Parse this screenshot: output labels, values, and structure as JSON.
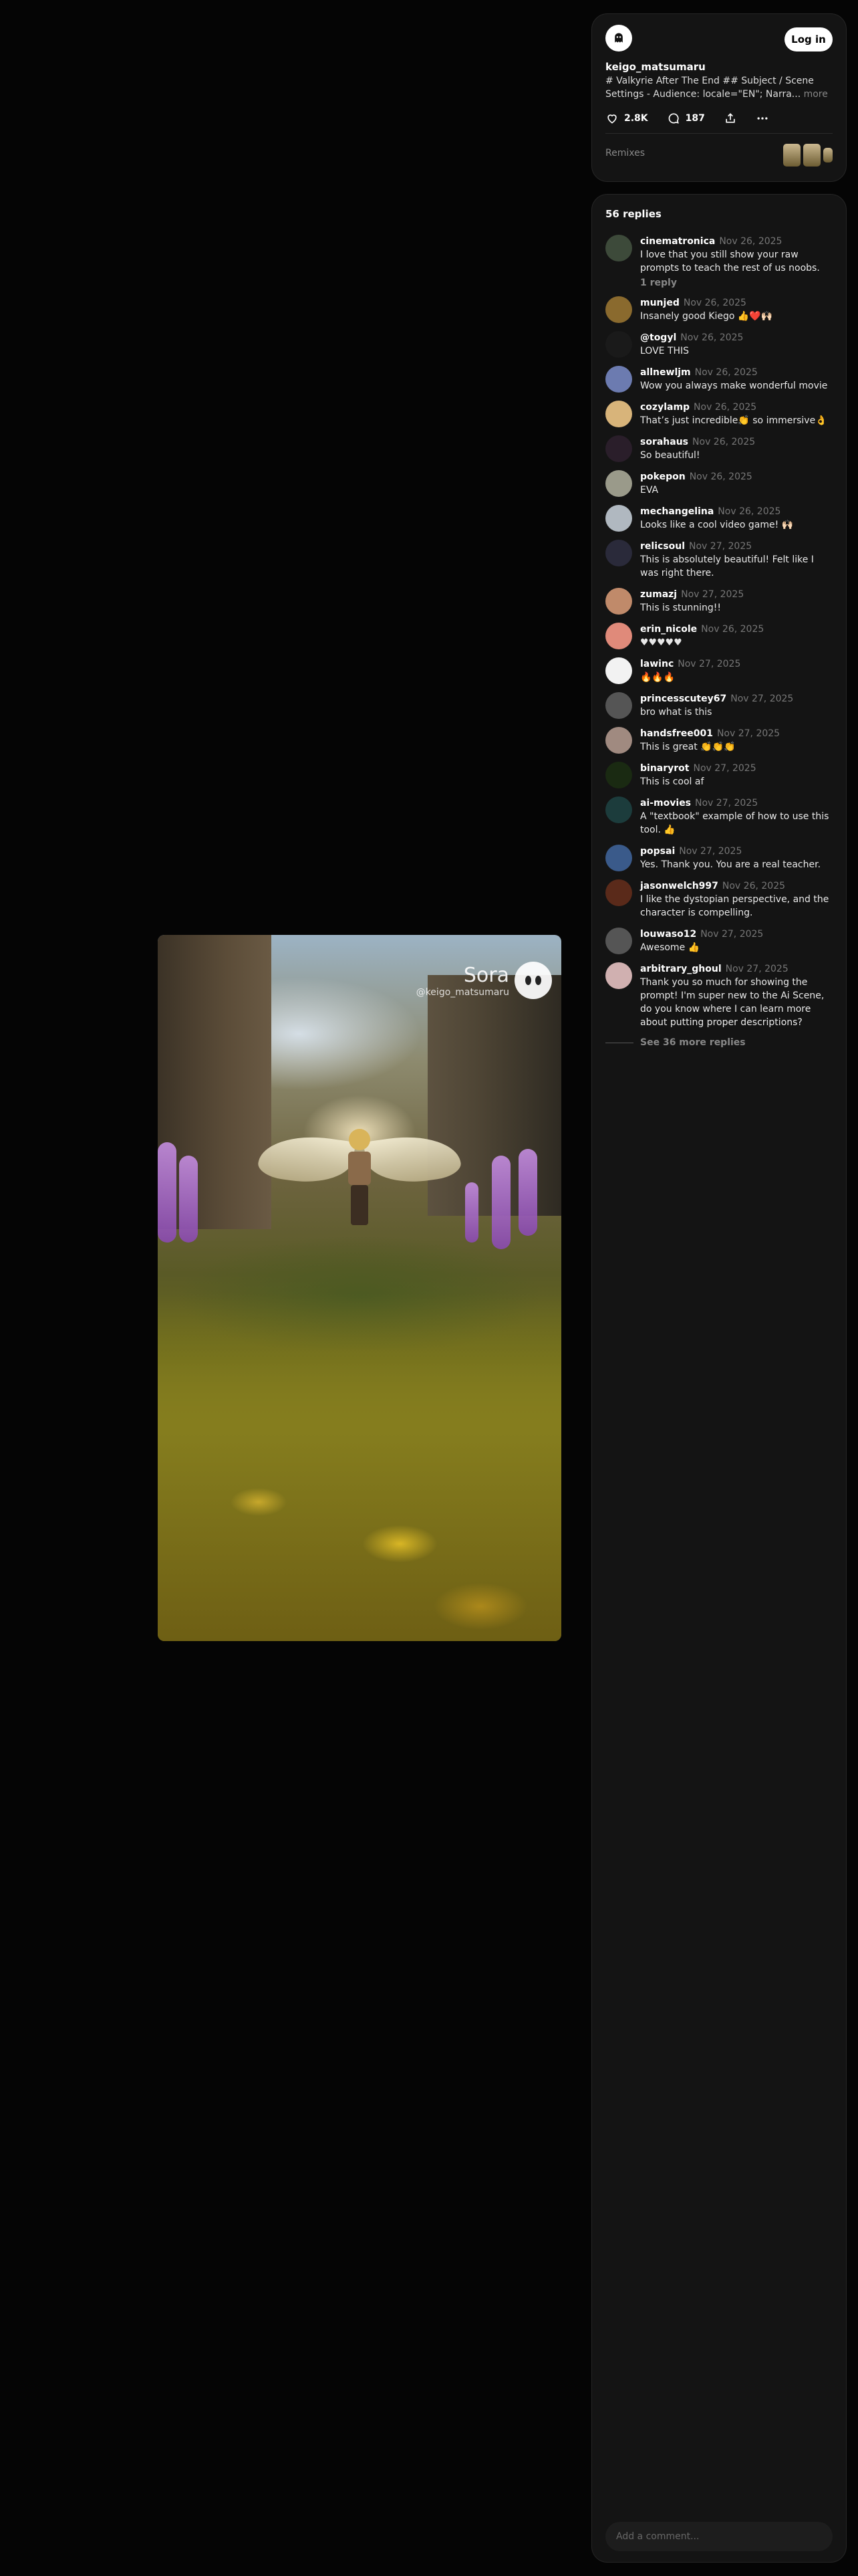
{
  "video": {
    "watermark_brand": "Sora",
    "watermark_user": "@keigo_matsumaru"
  },
  "post": {
    "author": "keigo_matsumaru",
    "description": "# Valkyrie After The End ## Subject / Scene Settings - Audience: locale=\"EN\"; Narra...",
    "more_label": "more",
    "login_label": "Log in",
    "likes": "2.8K",
    "comments_count": "187",
    "remixes_label": "Remixes"
  },
  "comments_section": {
    "title": "56 replies",
    "see_more": "See 36 more replies",
    "input_placeholder": "Add a comment...",
    "items": [
      {
        "user": "cinematronica",
        "date": "Nov 26, 2025",
        "text": "I love that you still show your raw prompts to teach the rest of us noobs.",
        "reply": "1 reply",
        "color": "#3d4a3a"
      },
      {
        "user": "munjed",
        "date": "Nov 26, 2025",
        "text": "Insanely good Kiego 👍❤️🙌🏻",
        "reply": "",
        "color": "#8a6a2e"
      },
      {
        "user": "@togyl",
        "date": "Nov 26, 2025",
        "text": "LOVE THIS",
        "reply": "",
        "color": "#1a1a1a"
      },
      {
        "user": "allnewljm",
        "date": "Nov 26, 2025",
        "text": "Wow you always make wonderful movie",
        "reply": "",
        "color": "#6c7bb0"
      },
      {
        "user": "cozylamp",
        "date": "Nov 26, 2025",
        "text": "That’s just incredible👏 so immersive👌",
        "reply": "",
        "color": "#d8b47a"
      },
      {
        "user": "sorahaus",
        "date": "Nov 26, 2025",
        "text": "So beautiful!",
        "reply": "",
        "color": "#2a1e2a"
      },
      {
        "user": "pokepon",
        "date": "Nov 26, 2025",
        "text": "EVA",
        "reply": "",
        "color": "#9a9a8a"
      },
      {
        "user": "mechangelina",
        "date": "Nov 26, 2025",
        "text": "Looks like a cool video game! 🙌🏻",
        "reply": "",
        "color": "#b0b8c0"
      },
      {
        "user": "relicsoul",
        "date": "Nov 27, 2025",
        "text": "This is absolutely beautiful! Felt like I was right there.",
        "reply": "",
        "color": "#2a2a3a"
      },
      {
        "user": "zumazj",
        "date": "Nov 27, 2025",
        "text": "This is stunning!!",
        "reply": "",
        "color": "#c08a6a"
      },
      {
        "user": "erin_nicole",
        "date": "Nov 26, 2025",
        "text": "♥♥♥♥♥",
        "reply": "",
        "color": "#e08a7a"
      },
      {
        "user": "lawinc",
        "date": "Nov 27, 2025",
        "text": "🔥🔥🔥",
        "reply": "",
        "color": "#f2f2f2"
      },
      {
        "user": "princesscutey67",
        "date": "Nov 27, 2025",
        "text": "bro what is this",
        "reply": "",
        "color": "#555555"
      },
      {
        "user": "handsfree001",
        "date": "Nov 27, 2025",
        "text": "This is great 👏👏👏",
        "reply": "",
        "color": "#a08a80"
      },
      {
        "user": "binaryrot",
        "date": "Nov 27, 2025",
        "text": "This is cool af",
        "reply": "",
        "color": "#1a2a12"
      },
      {
        "user": "ai-movies",
        "date": "Nov 27, 2025",
        "text": "A \"textbook\" example of how to use this tool. 👍",
        "reply": "",
        "color": "#1c3c3c"
      },
      {
        "user": "popsai",
        "date": "Nov 27, 2025",
        "text": "Yes. Thank you. You are a real teacher.",
        "reply": "",
        "color": "#3a5a8a"
      },
      {
        "user": "jasonwelch997",
        "date": "Nov 26, 2025",
        "text": "I like the dystopian perspective, and the character is compelling.",
        "reply": "",
        "color": "#5a2a1a"
      },
      {
        "user": "louwaso12",
        "date": "Nov 27, 2025",
        "text": "Awesome 👍",
        "reply": "",
        "color": "#555555"
      },
      {
        "user": "arbitrary_ghoul",
        "date": "Nov 27, 2025",
        "text": "Thank you so much for showing the prompt! I'm super new to the Ai Scene, do you know where I can learn more about putting proper descriptions?",
        "reply": "",
        "color": "#d0b0b0"
      }
    ]
  },
  "colors": {
    "background": "#050505",
    "panel": "#141414",
    "muted": "#888888"
  }
}
